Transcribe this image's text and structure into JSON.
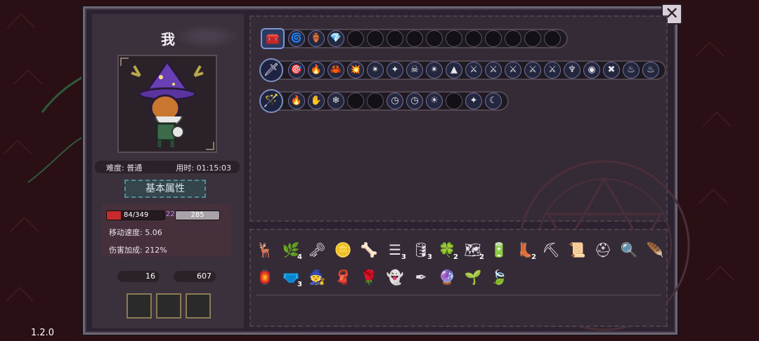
{
  "version": "1.2.0",
  "close_label": "✕",
  "character": {
    "name": "我",
    "difficulty": "难度: 普通",
    "time": "用时: 01:15:03",
    "attributes_tab": "基本属性",
    "hp": {
      "current": 84,
      "max": 349,
      "label": "84/349",
      "fraction": 0.24
    },
    "shield": "22",
    "exp": "285",
    "move_speed": "移动速度: 5.06",
    "damage_bonus": "伤害加成: 212%"
  },
  "resources": {
    "keys": "16",
    "gold": "607"
  },
  "colors": {
    "accent": "#c62a2a",
    "frame": "#6f6675",
    "panel": "#352b37",
    "tab_border": "#4f8c95"
  },
  "rows": [
    {
      "lead": "chest-icon",
      "slots": [
        {
          "icon": "swirl-icon",
          "glyph": "🌀"
        },
        {
          "icon": "jar-icon",
          "glyph": "🏺"
        },
        {
          "icon": "gem-icon",
          "glyph": "💎"
        },
        {
          "icon": "",
          "glyph": ""
        },
        {
          "icon": "",
          "glyph": ""
        },
        {
          "icon": "",
          "glyph": ""
        },
        {
          "icon": "",
          "glyph": ""
        },
        {
          "icon": "",
          "glyph": ""
        },
        {
          "icon": "",
          "glyph": ""
        },
        {
          "icon": "",
          "glyph": ""
        },
        {
          "icon": "",
          "glyph": ""
        },
        {
          "icon": "",
          "glyph": ""
        },
        {
          "icon": "",
          "glyph": ""
        },
        {
          "icon": "",
          "glyph": ""
        }
      ]
    },
    {
      "lead": "staff-weapon-icon",
      "slots": [
        {
          "icon": "target-icon",
          "glyph": "🎯"
        },
        {
          "icon": "fire-arrow-icon",
          "glyph": "🔥"
        },
        {
          "icon": "claw-icon",
          "glyph": "🦀"
        },
        {
          "icon": "flame-burst-icon",
          "glyph": "💥"
        },
        {
          "icon": "quad-icon",
          "glyph": "✴"
        },
        {
          "icon": "star-icon",
          "glyph": "✦"
        },
        {
          "icon": "skull-icon",
          "glyph": "☠"
        },
        {
          "icon": "quad-icon",
          "glyph": "✴"
        },
        {
          "icon": "rock-icon",
          "glyph": "▲"
        },
        {
          "icon": "slash-icon",
          "glyph": "⚔"
        },
        {
          "icon": "slash-icon",
          "glyph": "⚔"
        },
        {
          "icon": "slash-icon",
          "glyph": "⚔"
        },
        {
          "icon": "slash-icon",
          "glyph": "⚔"
        },
        {
          "icon": "slash-icon",
          "glyph": "⚔"
        },
        {
          "icon": "horn-icon",
          "glyph": "♆"
        },
        {
          "icon": "eye-icon",
          "glyph": "◉"
        },
        {
          "icon": "cross-icon",
          "glyph": "✖"
        },
        {
          "icon": "ember-icon",
          "glyph": "♨"
        },
        {
          "icon": "ember-icon",
          "glyph": "♨"
        }
      ]
    },
    {
      "lead": "wand-weapon-icon",
      "slots": [
        {
          "icon": "fire-arrow-icon",
          "glyph": "🔥"
        },
        {
          "icon": "glove-icon",
          "glyph": "✋"
        },
        {
          "icon": "crystal-icon",
          "glyph": "❄"
        },
        {
          "icon": "",
          "glyph": ""
        },
        {
          "icon": "",
          "glyph": ""
        },
        {
          "icon": "clock-icon",
          "glyph": "◷"
        },
        {
          "icon": "clock-icon",
          "glyph": "◷"
        },
        {
          "icon": "sun-icon",
          "glyph": "☀"
        },
        {
          "icon": "",
          "glyph": ""
        },
        {
          "icon": "star-icon",
          "glyph": "✦"
        },
        {
          "icon": "moon-icon",
          "glyph": "☾"
        }
      ]
    }
  ],
  "inventory": [
    [
      {
        "icon": "antler-icon",
        "glyph": "🦌",
        "count": ""
      },
      {
        "icon": "plant-icon",
        "glyph": "🌿",
        "count": "4"
      },
      {
        "icon": "key-icon",
        "glyph": "🗝",
        "count": ""
      },
      {
        "icon": "coin-icon",
        "glyph": "🪙",
        "count": ""
      },
      {
        "icon": "bone-icon",
        "glyph": "🦴",
        "count": ""
      },
      {
        "icon": "ribcage-icon",
        "glyph": "☰",
        "count": "3"
      },
      {
        "icon": "barrel-icon",
        "glyph": "🛢",
        "count": "3"
      },
      {
        "icon": "clover-icon",
        "glyph": "🍀",
        "count": "2"
      },
      {
        "icon": "map-icon",
        "glyph": "🗺",
        "count": "2"
      },
      {
        "icon": "battery-icon",
        "glyph": "🔋",
        "count": ""
      },
      {
        "icon": "boot-icon",
        "glyph": "👢",
        "count": "2"
      },
      {
        "icon": "pickaxe-icon",
        "glyph": "⛏",
        "count": ""
      },
      {
        "icon": "scroll-icon",
        "glyph": "📜",
        "count": ""
      },
      {
        "icon": "helmet-icon",
        "glyph": "⛑",
        "count": ""
      },
      {
        "icon": "magnifier-icon",
        "glyph": "🔍",
        "count": ""
      },
      {
        "icon": "wing-icon",
        "glyph": "🪶",
        "count": ""
      }
    ],
    [
      {
        "icon": "lantern-icon",
        "glyph": "🏮",
        "count": ""
      },
      {
        "icon": "belt-icon",
        "glyph": "🩲",
        "count": "3"
      },
      {
        "icon": "witch-hat-icon",
        "glyph": "🧙",
        "count": ""
      },
      {
        "icon": "scarf-icon",
        "glyph": "🧣",
        "count": ""
      },
      {
        "icon": "rose-icon",
        "glyph": "🌹",
        "count": ""
      },
      {
        "icon": "ghost-icon",
        "glyph": "👻",
        "count": ""
      },
      {
        "icon": "feather-pen-icon",
        "glyph": "✒",
        "count": ""
      },
      {
        "icon": "fire-orb-icon",
        "glyph": "🔮",
        "count": ""
      },
      {
        "icon": "sprout-icon",
        "glyph": "🌱",
        "count": ""
      },
      {
        "icon": "leaf-icon",
        "glyph": "🍃",
        "count": ""
      }
    ]
  ]
}
